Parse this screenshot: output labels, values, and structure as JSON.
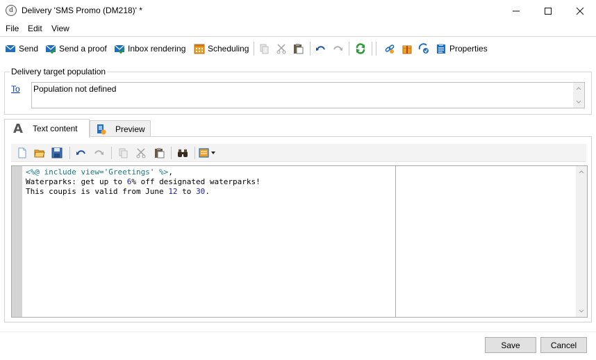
{
  "window": {
    "title": "Delivery 'SMS Promo (DM218)' *",
    "app_icon_glyph": "d"
  },
  "menu": [
    "File",
    "Edit",
    "View"
  ],
  "toolbar": {
    "send_label": "Send",
    "send_proof_label": "Send a proof",
    "inbox_rendering_label": "Inbox rendering",
    "scheduling_label": "Scheduling",
    "properties_label": "Properties"
  },
  "target": {
    "group_title": "Delivery target population",
    "to_label": "To",
    "population_text": "Population not defined"
  },
  "tabs": {
    "text_content": "Text content",
    "preview": "Preview",
    "text_icon_glyph": "A"
  },
  "editor": {
    "line1": {
      "pre": "<%@ include view='Greetings' %>",
      "post": ","
    },
    "line2": {
      "a": "Waterparks: get up to ",
      "n1": "6",
      "b": "% off designated waterparks!"
    },
    "line3": {
      "a": "This coupis is valid from June ",
      "n1": "12",
      "b": " to ",
      "n2": "30",
      "c": "."
    }
  },
  "buttons": {
    "save": "Save",
    "cancel": "Cancel"
  },
  "colors": {
    "link": "#0033cc",
    "code_directive": "#1a7a7a",
    "code_number": "#1a1ab8",
    "icon_blue": "#1e6fc4",
    "icon_green": "#2e9b3a",
    "icon_orange": "#f0a020"
  }
}
